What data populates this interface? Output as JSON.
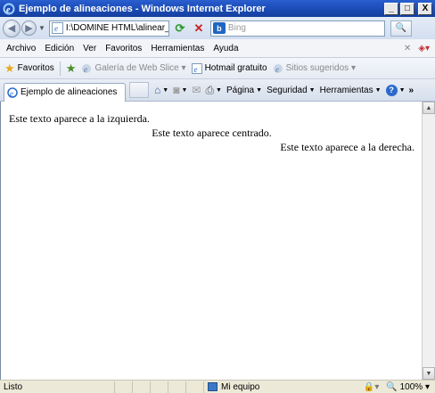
{
  "window": {
    "title": "Ejemplo de alineaciones - Windows Internet Explorer",
    "minimize": "_",
    "maximize": "□",
    "close": "X"
  },
  "address_bar": {
    "url": "I:\\DOMINE HTML\\alinear_1",
    "search_placeholder": "Bing",
    "search_engine_icon": "b"
  },
  "menu": {
    "items": [
      "Archivo",
      "Edición",
      "Ver",
      "Favoritos",
      "Herramientas",
      "Ayuda"
    ]
  },
  "favorites_bar": {
    "favorites_label": "Favoritos",
    "links": [
      "Galería de Web Slice",
      "Hotmail gratuito",
      "Sitios sugeridos"
    ]
  },
  "tab": {
    "title": "Ejemplo de alineaciones"
  },
  "commands": {
    "page": "Página",
    "safety": "Seguridad",
    "tools": "Herramientas",
    "help": "?"
  },
  "page": {
    "left_text": "Este texto aparece a la izquierda.",
    "center_text": "Este texto aparece centrado.",
    "right_text": "Este texto aparece a la derecha."
  },
  "status_bar": {
    "status": "Listo",
    "zone": "Mi equipo",
    "zoom": "100%"
  }
}
